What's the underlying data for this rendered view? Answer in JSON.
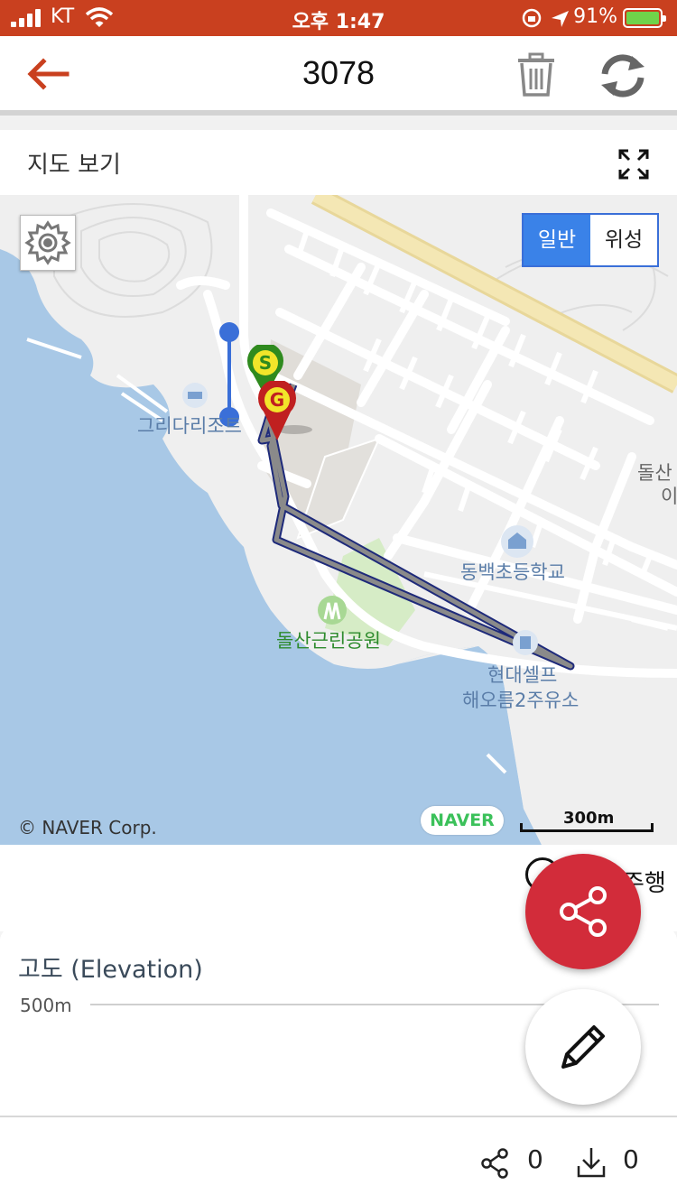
{
  "status_bar": {
    "carrier": "KT",
    "time": "오후 1:47",
    "battery_percent": "91%"
  },
  "header": {
    "title": "3078",
    "back_icon": "arrow-left-icon",
    "trash_icon": "trash-icon",
    "refresh_icon": "refresh-icon",
    "accent_color": "#c9401f"
  },
  "map_section": {
    "label": "지도 보기",
    "expand_icon": "expand-icon"
  },
  "map": {
    "settings_icon": "gear-icon",
    "map_types": [
      "일반",
      "위성"
    ],
    "selected_map_type": "일반",
    "pois": {
      "resort": "그리다리조트",
      "school": "동백초등학교",
      "park": "돌산근린공원",
      "gas_station_line1": "현대셀프",
      "gas_station_line2": "해오름2주유소",
      "edge_label_1": "돌산",
      "edge_label_2": "이"
    },
    "markers": {
      "start": "S",
      "goal": "G"
    },
    "copyright": "© NAVER Corp.",
    "brand": "NAVER",
    "scale": "300m"
  },
  "playback": {
    "label": "주행",
    "icon": "play-icon"
  },
  "elevation": {
    "title": "고도 (Elevation)",
    "axis_label": "500m"
  },
  "fabs": {
    "share_icon": "share-icon",
    "edit_icon": "pencil-icon",
    "share_color": "#d22c3a"
  },
  "footer": {
    "share_count": "0",
    "download_count": "0",
    "share_icon": "share-icon",
    "download_icon": "download-icon"
  }
}
